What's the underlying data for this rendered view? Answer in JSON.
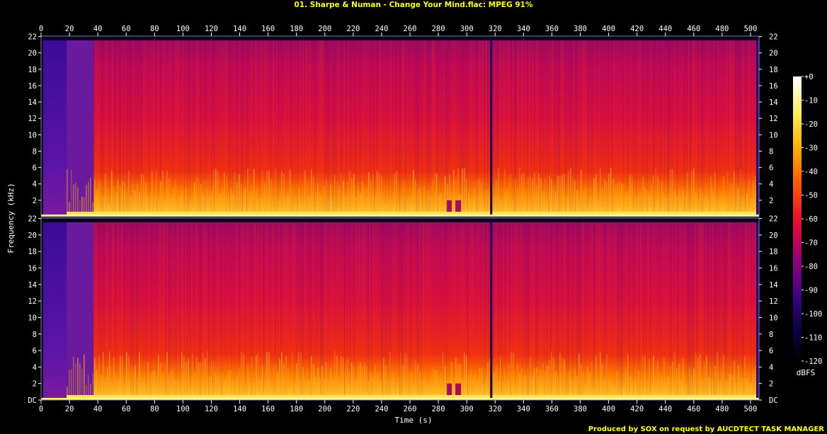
{
  "title": "01. Sharpe & Numan - Change Your Mind.flac: MPEG 91%",
  "footer": "Produced by SOX on request by AUCDTECT TASK MANAGER",
  "colors": {
    "title": "#ffff00",
    "text": "#ffffff",
    "background": "#000000",
    "frame": "#8080a0"
  },
  "chart_data": {
    "type": "heatmap",
    "title": "01. Sharpe & Numan - Change Your Mind.flac: MPEG 91%",
    "xlabel": "Time (s)",
    "ylabel": "Frequency (kHz)",
    "xlim": [
      0,
      506
    ],
    "ylim_khz": [
      0,
      22.05
    ],
    "x_ticks": [
      "0",
      "20",
      "40",
      "60",
      "80",
      "100",
      "120",
      "140",
      "160",
      "180",
      "200",
      "220",
      "240",
      "260",
      "280",
      "300",
      "320",
      "340",
      "360",
      "380",
      "400",
      "420",
      "440",
      "460",
      "480",
      "500"
    ],
    "y_ticks": [
      "DC",
      "2",
      "4",
      "6",
      "8",
      "10",
      "12",
      "14",
      "16",
      "18",
      "20",
      "22"
    ],
    "channels": 2,
    "colorbar": {
      "label": "dBFS",
      "range": [
        -120,
        0
      ],
      "ticks": [
        "+0",
        "-10",
        "-20",
        "-30",
        "-40",
        "-50",
        "-60",
        "-70",
        "-80",
        "-90",
        "-100",
        "-110",
        "-120"
      ],
      "stops": [
        "#000000",
        "#10004a",
        "#4b008d",
        "#a00070",
        "#e8102a",
        "#ff5a00",
        "#ffb000",
        "#ffee60",
        "#ffffff"
      ]
    },
    "features": {
      "quiet_intro_end_s": 18,
      "low_level_intro_end_s": 37,
      "dropout_s": 317,
      "end_silence_s": 504,
      "dark_gap_s": [
        286,
        296
      ]
    }
  }
}
